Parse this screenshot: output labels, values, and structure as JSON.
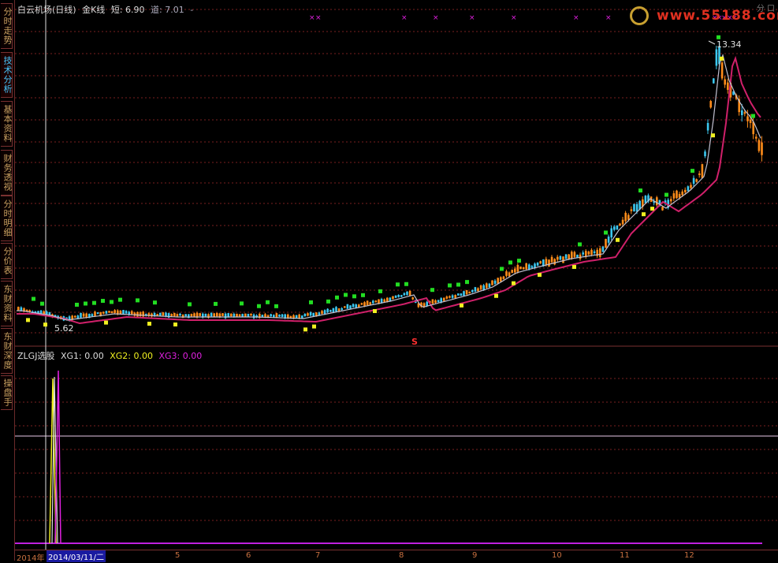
{
  "header": {
    "stock": "白云机场(日线)",
    "indicator": "金K线",
    "short_label": "短:",
    "short_value": "6.90",
    "road_label": "道:",
    "road_value": "7.01",
    "dash": "-"
  },
  "sub_header": {
    "name": "ZLGJ选股",
    "xg1": "XG1: 0.00",
    "xg2": "XG2: 0.00",
    "xg3": "XG3: 0.00"
  },
  "logo": {
    "text": "www.55188.com"
  },
  "corner": {
    "text": "分 口"
  },
  "annotations": {
    "high": "13.34",
    "low": "5.62",
    "signal": "S"
  },
  "side_tabs": [
    {
      "label": "分时走势",
      "state": "normal"
    },
    {
      "label": "技术分析",
      "state": "active"
    },
    {
      "label": "基本资料",
      "state": "normal"
    },
    {
      "label": "财务透视",
      "state": "normal"
    },
    {
      "label": "分时明细",
      "state": "normal"
    },
    {
      "label": "分价表",
      "state": "normal"
    },
    {
      "label": "东财资料",
      "state": "normal"
    },
    {
      "label": "东财深度",
      "state": "normal"
    },
    {
      "label": "操盘手",
      "state": "normal"
    }
  ],
  "x_axis": {
    "start": "2014年",
    "cursor_date": "2014/03/11/二",
    "months": [
      "5",
      "6",
      "7",
      "8",
      "9",
      "10",
      "11",
      "12"
    ]
  },
  "colors": {
    "up": "#ff8c1a",
    "down": "#3cc8f0",
    "ma_long": "#d0206a",
    "ma_short": "#c0c0d0",
    "grid": "#7a2020",
    "signal_green": "#22dd22",
    "signal_yellow": "#f0f020",
    "x_marker": "#e020e0"
  }
}
